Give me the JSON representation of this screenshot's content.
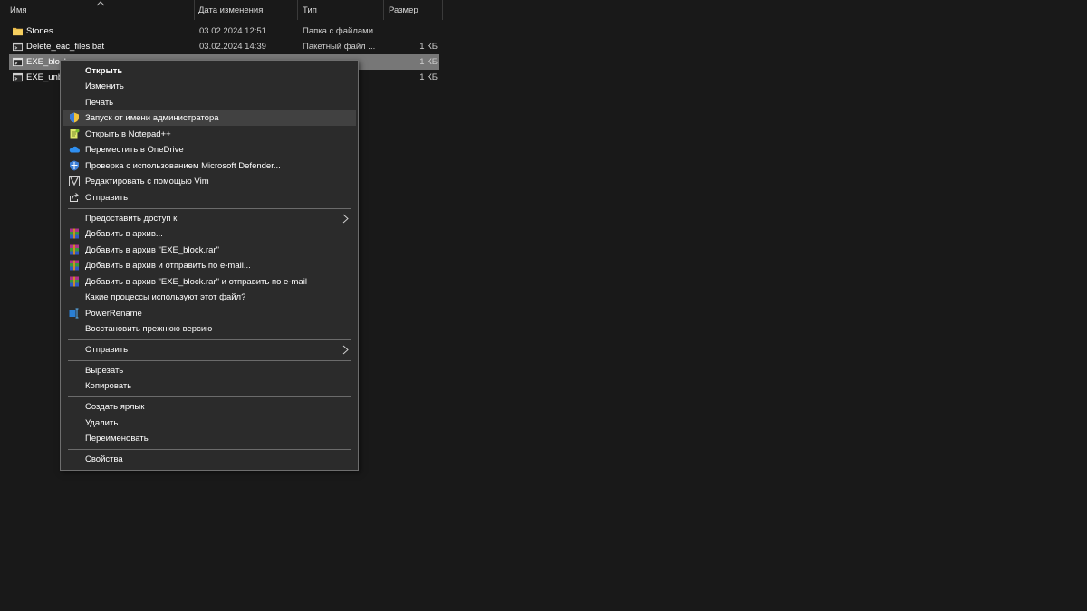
{
  "columns": [
    "Имя",
    "Дата изменения",
    "Тип",
    "Размер"
  ],
  "files": [
    {
      "name": "Stones",
      "date": "03.02.2024 12:51",
      "type": "Папка с файлами",
      "size": "",
      "icon": "folder-icon"
    },
    {
      "name": "Delete_eac_files.bat",
      "date": "03.02.2024 14:39",
      "type": "Пакетный файл ...",
      "size": "1 КБ",
      "icon": "batch-file-icon"
    },
    {
      "name": "EXE_block",
      "date": "",
      "type": "",
      "size": "1 КБ",
      "icon": "batch-file-icon",
      "selected": true
    },
    {
      "name": "EXE_unbl",
      "date": "",
      "type": "",
      "size": "1 КБ",
      "icon": "batch-file-icon"
    }
  ],
  "menu": {
    "open": "Открыть",
    "edit": "Изменить",
    "print": "Печать",
    "run_as_admin": "Запуск от имени администратора",
    "open_notepadpp": "Открыть в Notepad++",
    "move_onedrive": "Переместить в OneDrive",
    "defender_scan": "Проверка с использованием Microsoft Defender...",
    "edit_vim": "Редактировать с помощью Vim",
    "share": "Отправить",
    "give_access": "Предоставить доступ к",
    "add_archive": "Добавить в архив...",
    "add_archive_named": "Добавить в архив \"EXE_block.rar\"",
    "add_archive_email": "Добавить в архив и отправить по e-mail...",
    "add_archive_named_email": "Добавить в архив \"EXE_block.rar\" и отправить по e-mail",
    "which_processes": "Какие процессы используют этот файл?",
    "powerrename": "PowerRename",
    "restore_previous": "Восстановить прежнюю версию",
    "send_to": "Отправить",
    "cut": "Вырезать",
    "copy": "Копировать",
    "create_shortcut": "Создать ярлык",
    "delete": "Удалить",
    "rename": "Переименовать",
    "properties": "Свойства"
  },
  "colors": {
    "background": "#191919",
    "menu_bg": "#2b2b2b",
    "hover": "#414141",
    "selected_row": "#777777"
  }
}
